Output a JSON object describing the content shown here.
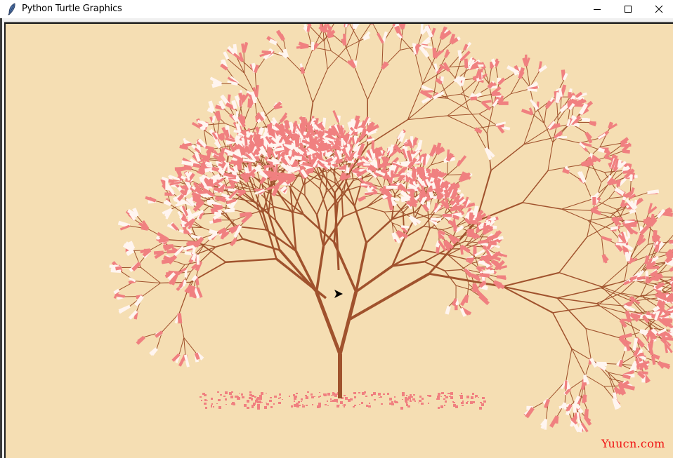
{
  "window": {
    "title": "Python Turtle Graphics",
    "app_icon": "feather-icon",
    "controls": {
      "minimize": "minimize-icon",
      "maximize": "maximize-icon",
      "close": "close-icon"
    }
  },
  "canvas": {
    "background_color": "#f5deb3",
    "watermark": "Yuucn.com",
    "watermark_color": "#f01414"
  },
  "scene": {
    "subject": "cherry blossom tree",
    "branch_color": "#a0522d",
    "blossom_colors": [
      "#f08080",
      "#fff5f0"
    ],
    "fallen_petal_color": "#f08080",
    "turtle_cursor_color": "#000000",
    "turtle_cursor_icon": "turtle-arrow-icon",
    "recursion_depth": 7
  }
}
